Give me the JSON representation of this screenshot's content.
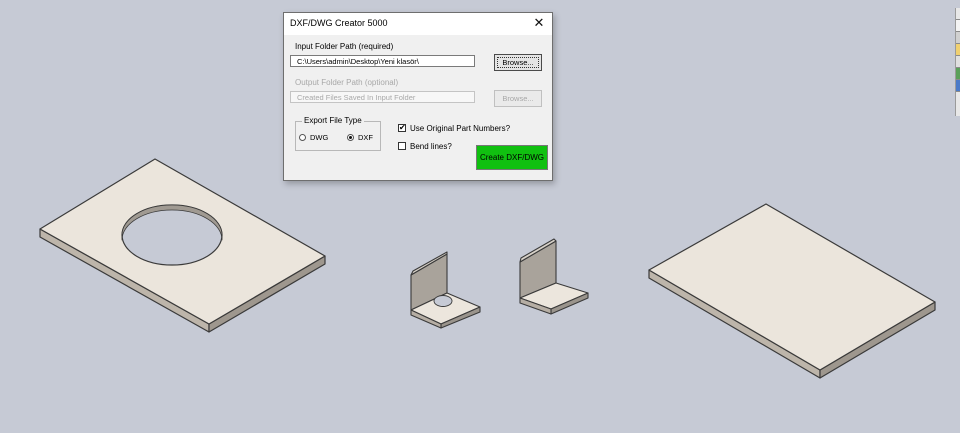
{
  "dialog": {
    "title": "DXF/DWG Creator 5000",
    "close_label": "✕",
    "input_label": "Input Folder Path (required)",
    "input_value": "C:\\Users\\admin\\Desktop\\Yeni klasör\\",
    "browse_label": "Browse...",
    "output_label": "Output Folder Path (optional)",
    "output_placeholder": "Created Files Saved In Input Folder",
    "browse_disabled_label": "Browse...",
    "export_group_label": "Export File Type",
    "radio_dwg_label": "DWG",
    "radio_dxf_label": "DXF",
    "selected_type": "DXF",
    "chk_original_label": "Use Original Part Numbers?",
    "chk_original_checked": true,
    "chk_bend_label": "Bend lines?",
    "chk_bend_checked": false,
    "create_label": "Create DXF/DWG"
  },
  "colors": {
    "background": "#c6cad5",
    "part_top": "#eae4da",
    "part_edge": "#b8b0a6",
    "create_button": "#10c010"
  },
  "scene": {
    "parts": [
      "plate-with-hole",
      "bracket-with-hole",
      "bracket-plain",
      "plain-plate"
    ]
  }
}
